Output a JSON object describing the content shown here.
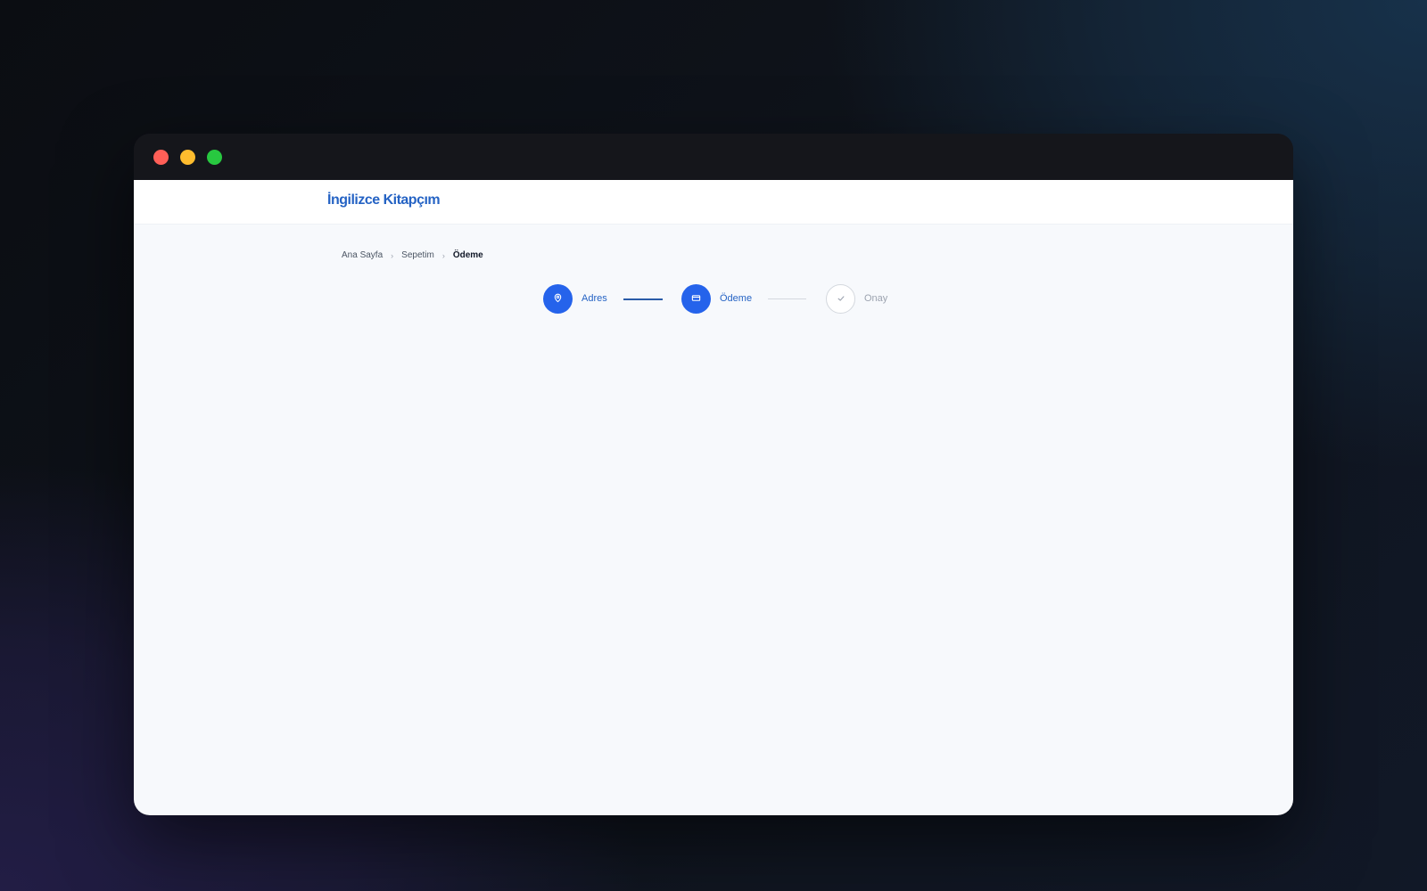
{
  "window": {
    "controls": [
      "close",
      "minimize",
      "maximize"
    ]
  },
  "header": {
    "logo_text": "İngilizce Kitapçım",
    "logo_color": "#2563c4"
  },
  "breadcrumb": {
    "items": [
      {
        "label": "Ana Sayfa"
      },
      {
        "label": "Sepetim"
      },
      {
        "label": "Ödeme"
      }
    ],
    "separator": "›"
  },
  "stepper": {
    "steps": [
      {
        "label": "Adres",
        "icon": "map-pin-icon",
        "state": "complete"
      },
      {
        "label": "Ödeme",
        "icon": "credit-card-icon",
        "state": "current"
      },
      {
        "label": "Onay",
        "icon": "check-icon",
        "state": "pending"
      }
    ],
    "accent_color": "#2563eb"
  },
  "colors": {
    "page_background": "#f7f9fc",
    "window_chrome": "#15161b",
    "close": "#ff5f57",
    "minimize": "#febc2e",
    "maximize": "#28c840"
  }
}
